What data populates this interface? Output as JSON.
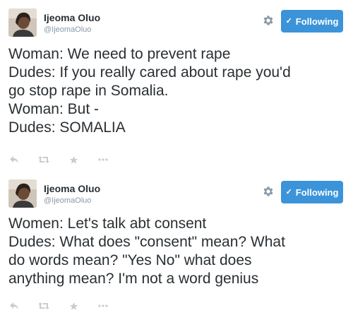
{
  "tweets": [
    {
      "display_name": "Ijeoma Oluo",
      "handle": "@IjeomaOluo",
      "follow_label": "Following",
      "lines": [
        "Woman: We need to prevent rape",
        "Dudes: If you really cared about rape you'd",
        "go stop rape in Somalia.",
        "Woman: But -",
        "Dudes: SOMALIA"
      ],
      "action_icons": [
        "reply-icon",
        "retweet-icon",
        "favorite-icon",
        "more-icon"
      ]
    },
    {
      "display_name": "Ijeoma Oluo",
      "handle": "@IjeomaOluo",
      "follow_label": "Following",
      "lines": [
        "Women: Let's talk abt consent",
        "Dudes: What does \"consent\" mean? What",
        "do words mean? \"Yes No\" what does",
        "anything mean? I'm not a word genius"
      ],
      "action_icons": [
        "reply-icon",
        "retweet-icon",
        "favorite-icon",
        "more-icon"
      ]
    }
  ],
  "colors": {
    "follow_button": "#3b94d9",
    "text": "#292f33",
    "muted": "#8899a6",
    "action_icon": "#c7cdd2"
  }
}
